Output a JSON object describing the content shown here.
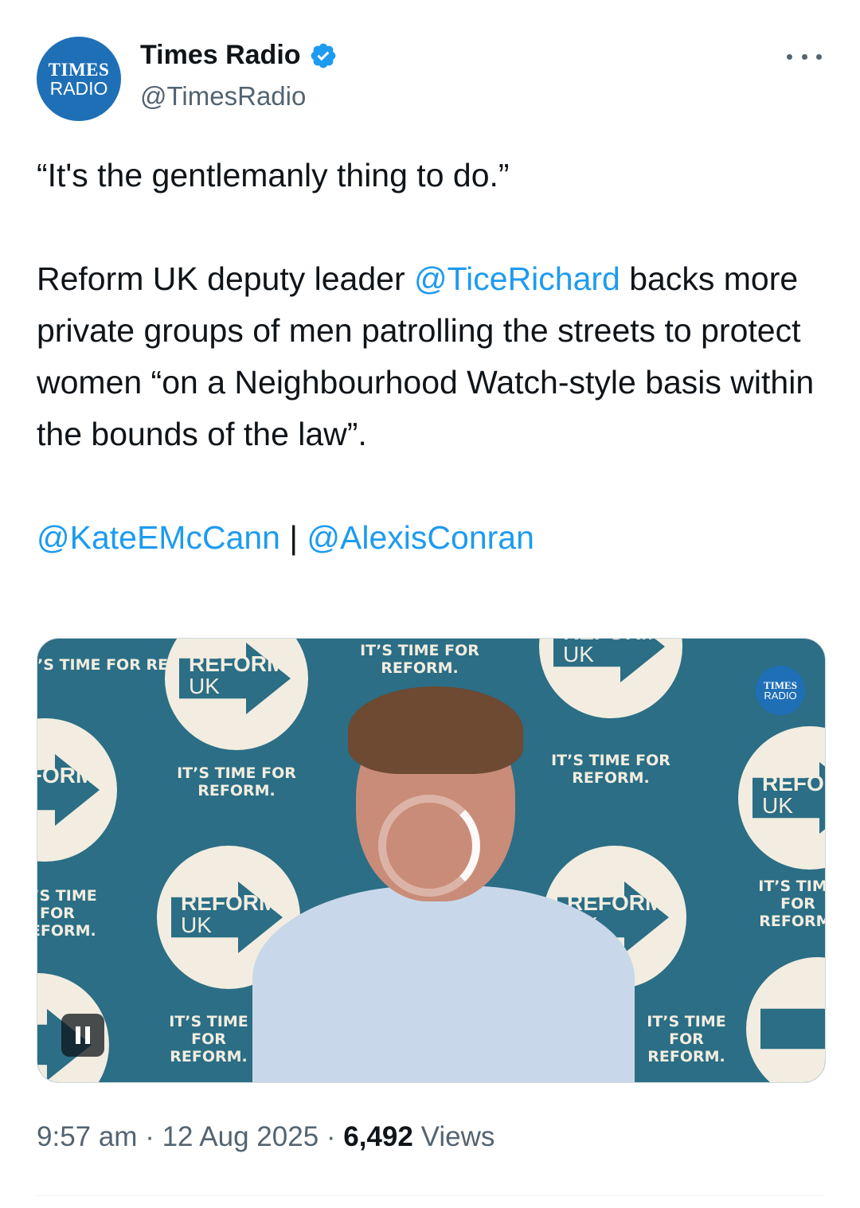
{
  "header": {
    "avatar_line1": "TIMES",
    "avatar_line2": "RADIO",
    "display_name": "Times Radio",
    "handle": "@TimesRadio"
  },
  "tweet": {
    "quote": "“It's the gentlemanly thing to do.”",
    "body_before_mention": "Reform UK deputy leader ",
    "mention": "@TiceRichard",
    "body_after_mention": " backs more private groups of men patrolling the streets to protect women “on a Neighbourhood Watch-style basis within the bounds of the law”.",
    "credit_mention_1": "@KateEMcCann",
    "credit_separator": " | ",
    "credit_mention_2": "@AlexisConran"
  },
  "video": {
    "backdrop_slogan": "IT’S TIME FOR REFORM.",
    "logo_word": "REFORM",
    "logo_uk": "UK",
    "watermark_line1": "TIMES",
    "watermark_line2": "RADIO"
  },
  "meta": {
    "time": "9:57 am",
    "separator": " · ",
    "date": "12 Aug 2025",
    "views_count": "6,492",
    "views_label": "Views"
  },
  "colors": {
    "link": "#1d9bf0",
    "text": "#0f1419",
    "secondary": "#536471",
    "brand_blue": "#1f6fb7",
    "backdrop_teal": "#2b6e85"
  },
  "icons": [
    "verified-badge-icon",
    "more-options-icon",
    "pause-icon",
    "loading-spinner-icon"
  ]
}
